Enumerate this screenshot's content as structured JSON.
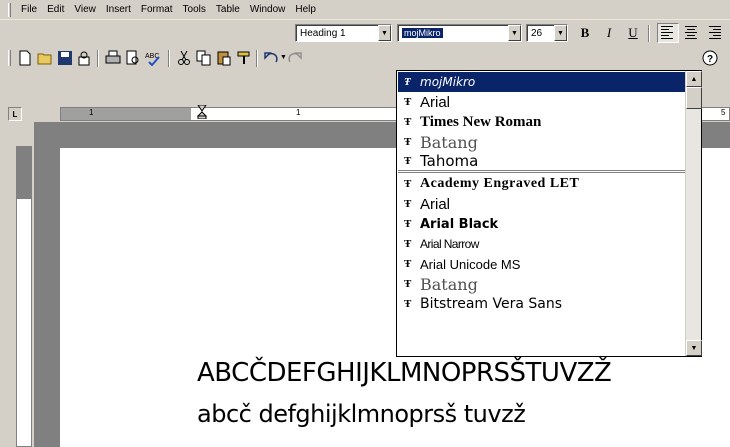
{
  "menu": [
    "File",
    "Edit",
    "View",
    "Insert",
    "Format",
    "Tools",
    "Table",
    "Window",
    "Help"
  ],
  "formatting": {
    "style": "Heading 1",
    "font": "mojMikro",
    "size": "26",
    "bold": "B",
    "italic": "I",
    "underline": "U"
  },
  "ruler": {
    "mark_left": "1",
    "mark_mid": "1",
    "mark_right": "5"
  },
  "font_list": {
    "recent": [
      {
        "label": "mojMikro",
        "selected": true
      },
      {
        "label": "Arial"
      },
      {
        "label": "Times New Roman"
      },
      {
        "label": "Batang"
      },
      {
        "label": "Tahoma"
      }
    ],
    "all": [
      {
        "label": "Academy Engraved LET"
      },
      {
        "label": "Arial"
      },
      {
        "label": "Arial Black"
      },
      {
        "label": "Arial Narrow"
      },
      {
        "label": "Arial Unicode MS"
      },
      {
        "label": "Batang"
      },
      {
        "label": "Bitstream Vera Sans"
      }
    ]
  },
  "document": {
    "line1": "ABCČDEFGHIJKLMNOPRSŠTUVZŽ",
    "line2": "abcč defghijklmnoprsš tuvzž"
  },
  "icons": [
    "new-document-icon",
    "open-folder-icon",
    "save-icon",
    "permission-icon",
    "print-icon",
    "print-preview-icon",
    "spelling-icon",
    "cut-icon",
    "copy-icon",
    "paste-icon",
    "format-painter-icon",
    "undo-icon",
    "redo-icon",
    "help-icon",
    "align-left-icon",
    "center-icon",
    "align-right-icon",
    "truetype-icon"
  ]
}
